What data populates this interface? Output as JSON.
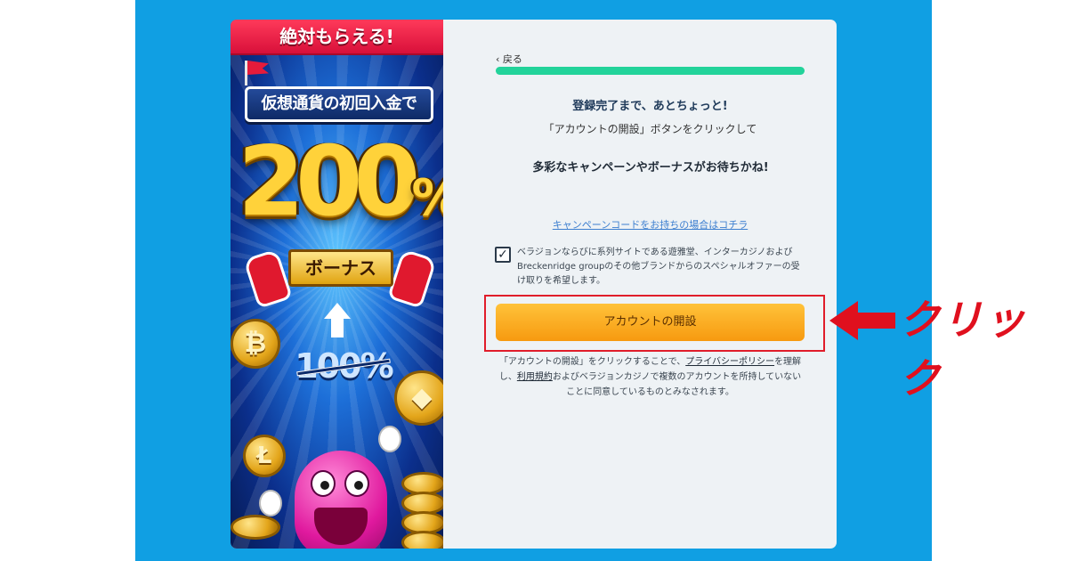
{
  "banner": {
    "ribbon": "絶対もらえる!",
    "headline": "仮想通貨の初回入金で",
    "percent_value": "200",
    "percent_sign": "%",
    "bonus_label": "ボーナス",
    "old_percent": "100%",
    "coin_symbols": [
      "₿",
      "Ł",
      "◆"
    ]
  },
  "form": {
    "back_label": "‹ 戻る",
    "progress": 1.0,
    "title": "登録完了まで、あとちょっと!",
    "subtitle": "「アカウントの開設」ボタンをクリックして",
    "promo": "多彩なキャンペーンやボーナスがお待ちかね!",
    "promo_code_link": "キャンペーンコードをお持ちの場合はコチラ",
    "consent_checked": true,
    "consent_text": "ベラジョンならびに系列サイトである遊雅堂、インターカジノおよびBreckenridge groupのその他ブランドからのスペシャルオファーの受け取りを希望します。",
    "cta_label": "アカウントの開設",
    "legal_1": "「アカウントの開設」をクリックすることで、",
    "legal_privacy": "プライバシーポリシー",
    "legal_2": "を理解し、",
    "legal_terms": "利用規約",
    "legal_3": "およびベラジョンカジノで複数のアカウントを所持していないことに同意しているものとみなされます。"
  },
  "annotation": {
    "label": "クリック",
    "color": "#e0101e"
  },
  "colors": {
    "background": "#109fe3",
    "progress": "#22d39a",
    "cta": "#f9a825"
  }
}
